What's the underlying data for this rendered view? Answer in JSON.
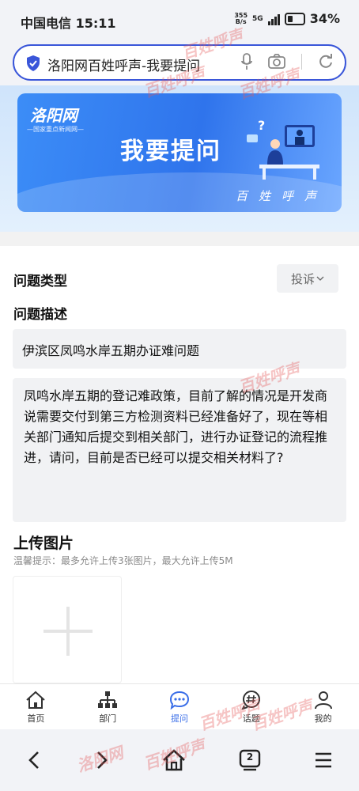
{
  "status": {
    "carrier": "中国电信",
    "time": "15:11",
    "net_speed_value": "355",
    "net_speed_unit": "B/s",
    "network": "5G",
    "battery": "34%"
  },
  "browser": {
    "url_title": "洛阳网百姓呼声-我要提问"
  },
  "banner": {
    "logo": "洛阳网",
    "logo_sub": "—国家重点新闻网—",
    "title": "我要提问",
    "tagline": "百姓呼声"
  },
  "form": {
    "type_label": "问题类型",
    "type_value": "投诉",
    "desc_label": "问题描述",
    "title_value": "伊滨区凤鸣水岸五期办证难问题",
    "desc_value": "凤鸣水岸五期的登记难政策，目前了解的情况是开发商说需要交付到第三方检测资料已经准备好了，现在等相关部门通知后提交到相关部门，进行办证登记的流程推进，请问，目前是否已经可以提交相关材料了?",
    "upload_label": "上传图片",
    "upload_hint": "温馨提示：最多允许上传3张图片，最大允许上传5M"
  },
  "tabs": [
    {
      "label": "首页",
      "icon": "home-icon"
    },
    {
      "label": "部门",
      "icon": "org-chart-icon"
    },
    {
      "label": "提问",
      "icon": "chat-bubble-icon",
      "active": true
    },
    {
      "label": "话题",
      "icon": "hashtag-bubble-icon"
    },
    {
      "label": "我的",
      "icon": "user-icon"
    }
  ],
  "browser_nav": {
    "tab_count": "2"
  },
  "watermark": {
    "text_a": "洛阳网",
    "text_b": "百姓呼声"
  },
  "colors": {
    "accent": "#3a56d9",
    "tab_active": "#3a6ee8",
    "banner_blue": "#2f74ec",
    "field_bg": "#f1f2f4"
  }
}
